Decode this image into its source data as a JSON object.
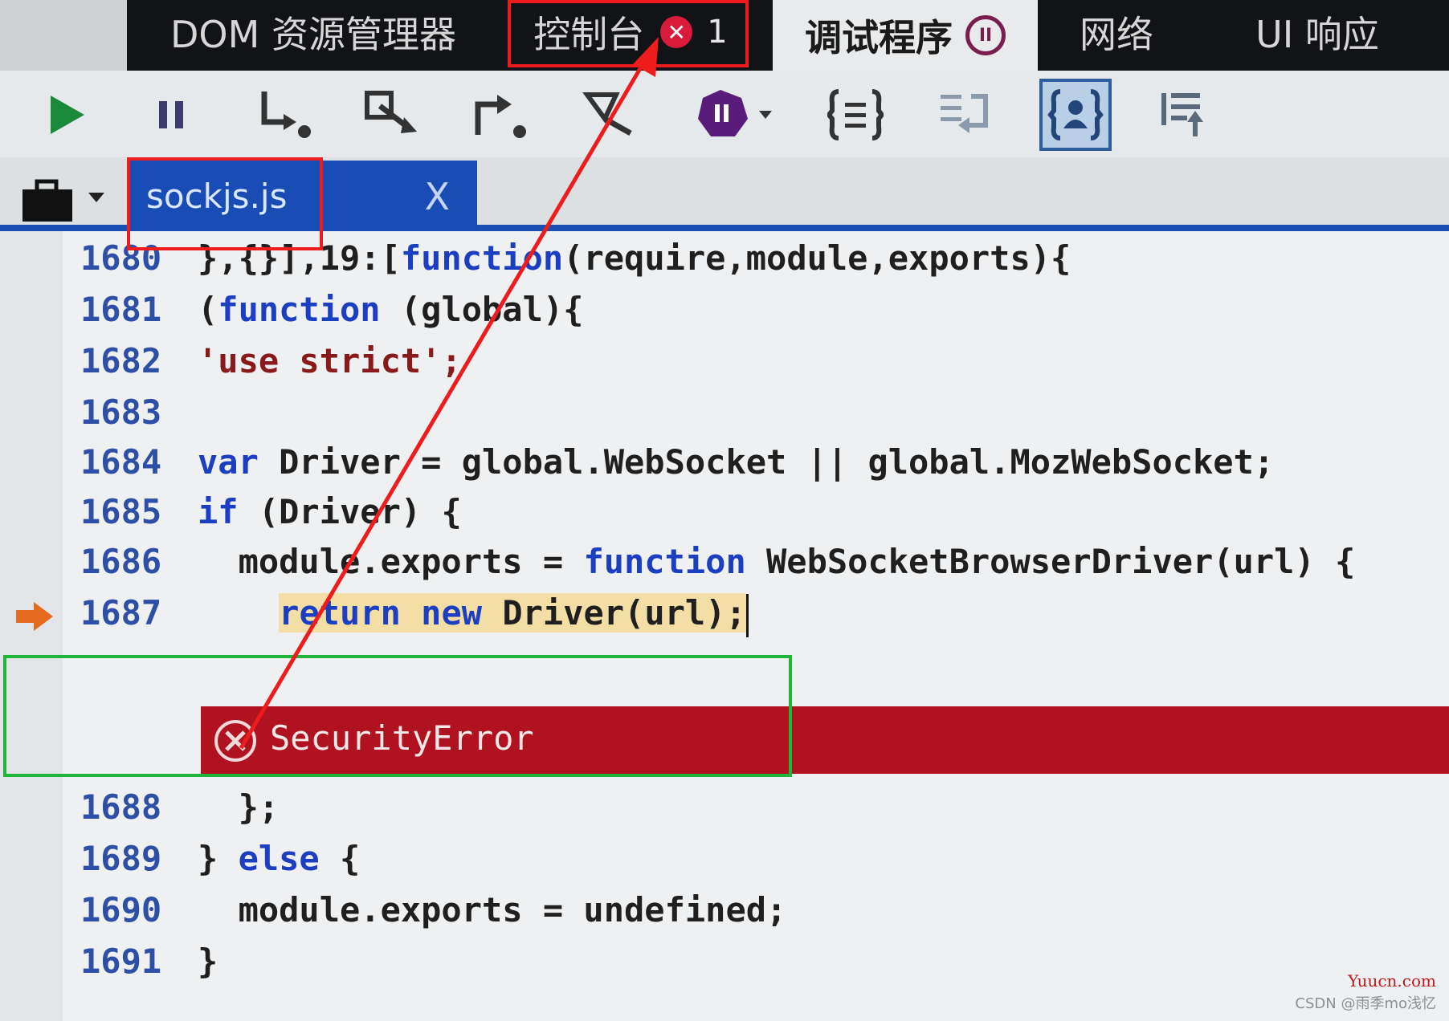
{
  "tabs": [
    {
      "label": "DOM 资源管理器",
      "active": false
    },
    {
      "label": "控制台",
      "active": false,
      "error_count": "1"
    },
    {
      "label": "调试程序",
      "active": true
    },
    {
      "label": "网络",
      "active": false
    },
    {
      "label": "UI 响应",
      "active": false
    }
  ],
  "toolbar": {
    "buttons": [
      "continue-icon",
      "pause-icon",
      "step-into-icon",
      "step-over-icon",
      "step-out-icon",
      "break-on-new-worker-icon",
      "exception-behavior-icon",
      "pretty-print-icon",
      "word-wrap-icon",
      "just-my-code-icon",
      "show-call-stack-icon"
    ]
  },
  "file_tab": {
    "name": "sockjs.js",
    "close": "X"
  },
  "code_lines": [
    {
      "num": "1680",
      "text": "},{}],19:[function(require,module,exports){"
    },
    {
      "num": "1681",
      "text": "(function (global){"
    },
    {
      "num": "1682",
      "text": "'use strict';"
    },
    {
      "num": "1683",
      "text": ""
    },
    {
      "num": "1684",
      "text": "var Driver = global.WebSocket || global.MozWebSocket;"
    },
    {
      "num": "1685",
      "text": "if (Driver) {"
    },
    {
      "num": "1686",
      "text": "  module.exports = function WebSocketBrowserDriver(url) {"
    },
    {
      "num": "1687",
      "text": "    return new Driver(url);"
    },
    {
      "num": "1688",
      "text": "  };"
    },
    {
      "num": "1689",
      "text": "} else {"
    },
    {
      "num": "1690",
      "text": "  module.exports = undefined;"
    },
    {
      "num": "1691",
      "text": "}"
    }
  ],
  "error": {
    "text": "SecurityError"
  },
  "watermark": {
    "site": "Yuucn.com",
    "credit": "CSDN @雨季mo浅忆"
  },
  "colors": {
    "accent_blue": "#1a4cb6",
    "error_red": "#b0121f",
    "annotation_red": "#ee1c1c",
    "annotation_green": "#1fb53a"
  }
}
